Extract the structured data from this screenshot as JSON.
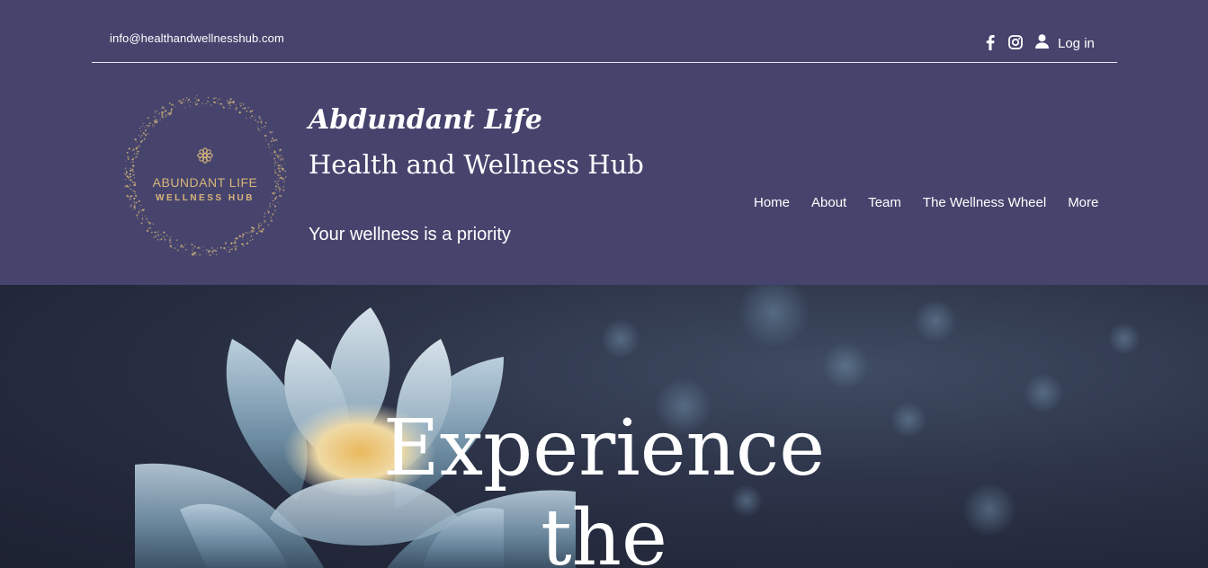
{
  "topbar": {
    "email": "info@healthandwellnesshub.com",
    "social": [
      {
        "name": "facebook-icon"
      },
      {
        "name": "instagram-icon"
      }
    ],
    "login_label": "Log in"
  },
  "brand": {
    "logo_line_1": "ABUNDANT LIFE",
    "logo_line_2": "WELLNESS HUB",
    "title": "Abdundant Life",
    "subtitle": "Health and Wellness Hub",
    "tagline": "Your wellness is a priority"
  },
  "nav": {
    "items": [
      {
        "label": "Home"
      },
      {
        "label": "About"
      },
      {
        "label": "Team"
      },
      {
        "label": "The Wellness Wheel"
      },
      {
        "label": "More"
      }
    ]
  },
  "hero": {
    "title_line_1": "Experience",
    "title_line_2": "the"
  },
  "colors": {
    "header_bg": "#46446d",
    "logo_gold": "#d7b57a",
    "hero_bg": "#262c3f"
  }
}
